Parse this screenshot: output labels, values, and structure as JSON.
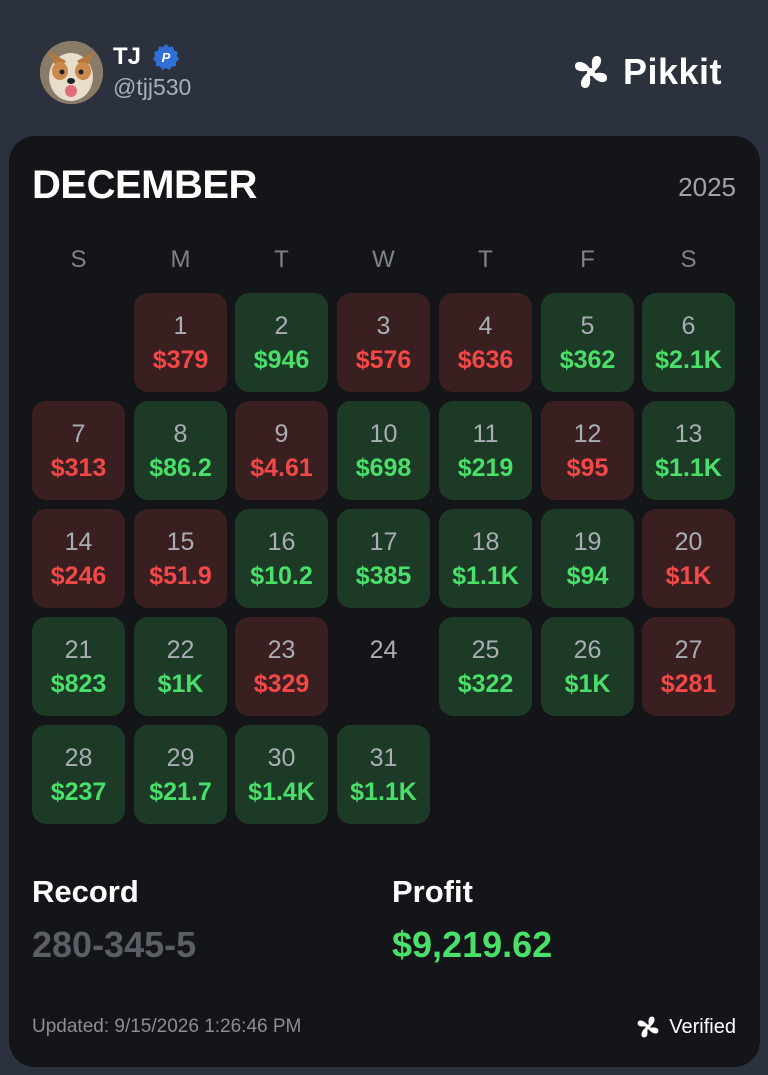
{
  "user": {
    "name": "TJ",
    "handle": "@tjj530",
    "avatar": "dog-avatar",
    "badge": "P"
  },
  "brand": {
    "name": "Pikkit",
    "icon": "clover-logo-icon"
  },
  "calendar": {
    "month": "DECEMBER",
    "year": "2025",
    "weekdays": [
      "S",
      "M",
      "T",
      "W",
      "T",
      "F",
      "S"
    ],
    "days": [
      {
        "day": "1",
        "amount": "$379",
        "result": "loss"
      },
      {
        "day": "2",
        "amount": "$946",
        "result": "win"
      },
      {
        "day": "3",
        "amount": "$576",
        "result": "loss"
      },
      {
        "day": "4",
        "amount": "$636",
        "result": "loss"
      },
      {
        "day": "5",
        "amount": "$362",
        "result": "win"
      },
      {
        "day": "6",
        "amount": "$2.1K",
        "result": "win"
      },
      {
        "day": "7",
        "amount": "$313",
        "result": "loss"
      },
      {
        "day": "8",
        "amount": "$86.2",
        "result": "win"
      },
      {
        "day": "9",
        "amount": "$4.61",
        "result": "loss"
      },
      {
        "day": "10",
        "amount": "$698",
        "result": "win"
      },
      {
        "day": "11",
        "amount": "$219",
        "result": "win"
      },
      {
        "day": "12",
        "amount": "$95",
        "result": "loss"
      },
      {
        "day": "13",
        "amount": "$1.1K",
        "result": "win"
      },
      {
        "day": "14",
        "amount": "$246",
        "result": "loss"
      },
      {
        "day": "15",
        "amount": "$51.9",
        "result": "loss"
      },
      {
        "day": "16",
        "amount": "$10.2",
        "result": "win"
      },
      {
        "day": "17",
        "amount": "$385",
        "result": "win"
      },
      {
        "day": "18",
        "amount": "$1.1K",
        "result": "win"
      },
      {
        "day": "19",
        "amount": "$94",
        "result": "win"
      },
      {
        "day": "20",
        "amount": "$1K",
        "result": "loss"
      },
      {
        "day": "21",
        "amount": "$823",
        "result": "win"
      },
      {
        "day": "22",
        "amount": "$1K",
        "result": "win"
      },
      {
        "day": "23",
        "amount": "$329",
        "result": "loss"
      },
      {
        "day": "24",
        "amount": "",
        "result": "none"
      },
      {
        "day": "25",
        "amount": "$322",
        "result": "win"
      },
      {
        "day": "26",
        "amount": "$1K",
        "result": "win"
      },
      {
        "day": "27",
        "amount": "$281",
        "result": "loss"
      },
      {
        "day": "28",
        "amount": "$237",
        "result": "win"
      },
      {
        "day": "29",
        "amount": "$21.7",
        "result": "win"
      },
      {
        "day": "30",
        "amount": "$1.4K",
        "result": "win"
      },
      {
        "day": "31",
        "amount": "$1.1K",
        "result": "win"
      }
    ]
  },
  "stats": {
    "record_label": "Record",
    "record_value": "280-345-5",
    "profit_label": "Profit",
    "profit_value": "$9,219.62"
  },
  "footer": {
    "updated": "Updated: 9/15/2026 1:26:46 PM",
    "verified": "Verified"
  },
  "colors": {
    "win_bg": "#1c3a26",
    "loss_bg": "#3a1f20",
    "win_text": "#4ade6a",
    "loss_text": "#f24848",
    "badge_blue": "#2f6fd6"
  }
}
